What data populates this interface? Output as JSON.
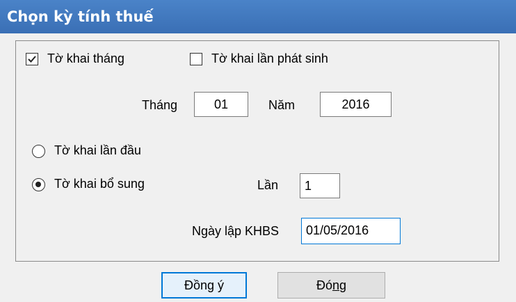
{
  "window": {
    "title": "Chọn kỳ tính thuế"
  },
  "options": {
    "monthly": {
      "label": "Tờ khai tháng",
      "checked": true
    },
    "incidental": {
      "label": "Tờ khai lần phát sinh",
      "checked": false
    }
  },
  "period": {
    "month_label": "Tháng",
    "month_value": "01",
    "year_label": "Năm",
    "year_value": "2016"
  },
  "declaration_type": {
    "first": {
      "label": "Tờ khai lần đầu",
      "selected": false
    },
    "supplement": {
      "label": "Tờ khai bổ sung",
      "selected": true
    }
  },
  "supplement": {
    "times_label": "Lần",
    "times_value": "1",
    "date_label": "Ngày lập KHBS",
    "date_value": "01/05/2016"
  },
  "buttons": {
    "ok_prefix": "Đồn",
    "ok_mnemonic": "g",
    "ok_suffix": " ý",
    "close_prefix": "Đó",
    "close_mnemonic": "n",
    "close_suffix": "g"
  },
  "colors": {
    "title_bar": "#3f78be",
    "focus": "#0078d7"
  }
}
